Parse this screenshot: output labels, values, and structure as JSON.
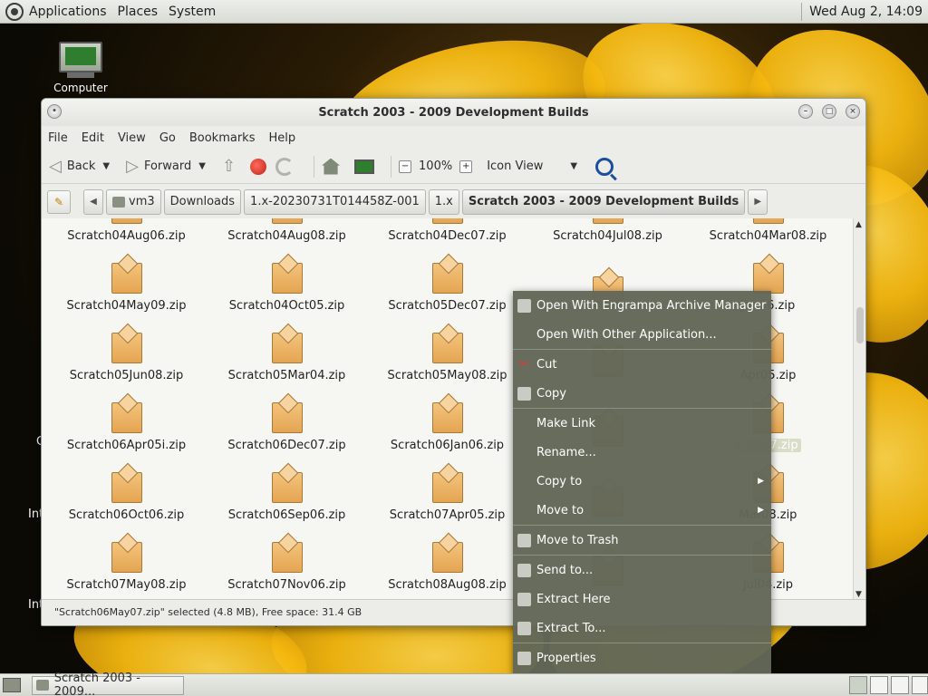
{
  "top_panel": {
    "menus": [
      "Applications",
      "Places",
      "System"
    ],
    "clock": "Wed Aug  2, 14:09"
  },
  "desktop": {
    "icons": [
      {
        "label": "Computer"
      }
    ],
    "partial_labels": [
      "C",
      "Int",
      "Int"
    ]
  },
  "window": {
    "title": "Scratch 2003 - 2009 Development Builds",
    "menubar": [
      "File",
      "Edit",
      "View",
      "Go",
      "Bookmarks",
      "Help"
    ],
    "toolbar": {
      "back": "Back",
      "forward": "Forward",
      "zoom": "100%",
      "view_mode": "Icon View"
    },
    "breadcrumbs": [
      "vm3",
      "Downloads",
      "1.x-20230731T014458Z-001",
      "1.x",
      "Scratch 2003 - 2009 Development Builds"
    ],
    "status": "\"Scratch06May07.zip\" selected (4.8 MB), Free space: 31.4 GB"
  },
  "files": [
    {
      "name": "Scratch04Aug06.zip"
    },
    {
      "name": "Scratch04Aug08.zip"
    },
    {
      "name": "Scratch04Dec07.zip"
    },
    {
      "name": "Scratch04Jul08.zip"
    },
    {
      "name": "Scratch04Mar08.zip"
    },
    {
      "name": "Scratch04May09.zip"
    },
    {
      "name": "Scratch04Oct05.zip"
    },
    {
      "name": "Scratch05Dec07.zip"
    },
    {
      "name": ""
    },
    {
      "name": "Jan06.zip"
    },
    {
      "name": "Scratch05Jun08.zip"
    },
    {
      "name": "Scratch05Mar04.zip"
    },
    {
      "name": "Scratch05May08.zip"
    },
    {
      "name": ""
    },
    {
      "name": "Apr05.zip"
    },
    {
      "name": "Scratch06Apr05i.zip"
    },
    {
      "name": "Scratch06Dec07.zip"
    },
    {
      "name": "Scratch06Jan06.zip"
    },
    {
      "name": ""
    },
    {
      "name": "May07.zip",
      "selected": true
    },
    {
      "name": "Scratch06Oct06.zip"
    },
    {
      "name": "Scratch06Sep06.zip"
    },
    {
      "name": "Scratch07Apr05.zip"
    },
    {
      "name": ""
    },
    {
      "name": "Mar08.zip"
    },
    {
      "name": "Scratch07May08.zip"
    },
    {
      "name": "Scratch07Nov06.zip"
    },
    {
      "name": "Scratch08Aug08.zip"
    },
    {
      "name": ""
    },
    {
      "name": "Jul04.zip"
    },
    {
      "name": ""
    },
    {
      "name": ""
    },
    {
      "name": ""
    },
    {
      "name": ""
    },
    {
      "name": ""
    }
  ],
  "context_menu": {
    "items": [
      {
        "label": "Open With Engrampa Archive Manager",
        "icon": "archive-icon"
      },
      {
        "label": "Open With Other Application...",
        "icon": ""
      },
      {
        "sep": true
      },
      {
        "label": "Cut",
        "icon": "scissors-icon"
      },
      {
        "label": "Copy",
        "icon": "copy-icon"
      },
      {
        "sep": true
      },
      {
        "label": "Make Link",
        "icon": ""
      },
      {
        "label": "Rename...",
        "icon": ""
      },
      {
        "label": "Copy to",
        "icon": "",
        "submenu": true
      },
      {
        "label": "Move to",
        "icon": "",
        "submenu": true
      },
      {
        "sep": true
      },
      {
        "label": "Move to Trash",
        "icon": "trash-icon"
      },
      {
        "sep": true
      },
      {
        "label": "Send to...",
        "icon": "send-icon"
      },
      {
        "label": "Extract Here",
        "icon": "extract-icon"
      },
      {
        "label": "Extract To...",
        "icon": "extract-to-icon"
      },
      {
        "sep": true
      },
      {
        "label": "Properties",
        "icon": "properties-icon"
      }
    ]
  },
  "bottom_panel": {
    "task_label": "Scratch 2003 - 2009..."
  }
}
